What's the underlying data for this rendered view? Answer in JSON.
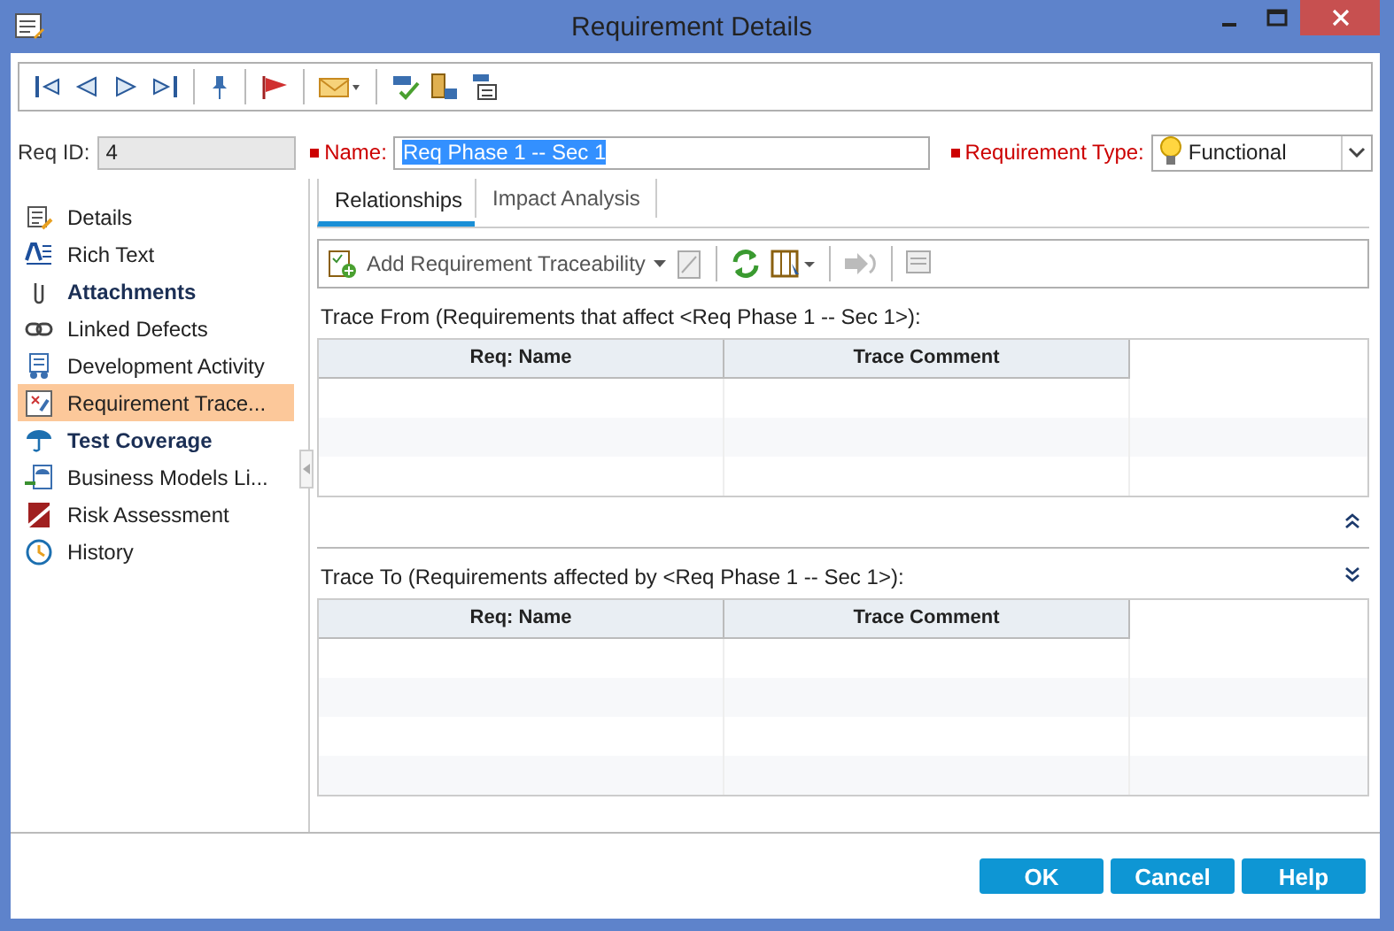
{
  "window": {
    "title": "Requirement Details"
  },
  "fields": {
    "req_id": {
      "label": "Req ID:",
      "value": "4"
    },
    "name": {
      "label": "Name:",
      "value": "Req Phase 1 -- Sec 1",
      "required": true
    },
    "requirement_type": {
      "label": "Requirement Type:",
      "value": "Functional",
      "required": true
    }
  },
  "sidebar": {
    "items": [
      {
        "label": "Details",
        "bold": false,
        "selected": false
      },
      {
        "label": "Rich Text",
        "bold": false,
        "selected": false
      },
      {
        "label": "Attachments",
        "bold": true,
        "selected": false
      },
      {
        "label": "Linked Defects",
        "bold": false,
        "selected": false
      },
      {
        "label": "Development Activity",
        "bold": false,
        "selected": false
      },
      {
        "label": "Requirement Trace...",
        "bold": false,
        "selected": true
      },
      {
        "label": "Test Coverage",
        "bold": true,
        "selected": false
      },
      {
        "label": "Business Models Li...",
        "bold": false,
        "selected": false
      },
      {
        "label": "Risk Assessment",
        "bold": false,
        "selected": false
      },
      {
        "label": "History",
        "bold": false,
        "selected": false
      }
    ]
  },
  "tabs": [
    {
      "label": "Relationships",
      "selected": true
    },
    {
      "label": "Impact Analysis",
      "selected": false
    }
  ],
  "panel_toolbar": {
    "add_label": "Add Requirement Traceability"
  },
  "trace_from": {
    "title": "Trace From (Requirements that affect <Req Phase 1 -- Sec 1>):",
    "columns": [
      "Req: Name",
      "Trace Comment"
    ]
  },
  "trace_to": {
    "title": "Trace To (Requirements affected by <Req Phase 1 -- Sec 1>):",
    "columns": [
      "Req: Name",
      "Trace Comment"
    ]
  },
  "buttons": [
    "OK",
    "Cancel",
    "Help"
  ]
}
